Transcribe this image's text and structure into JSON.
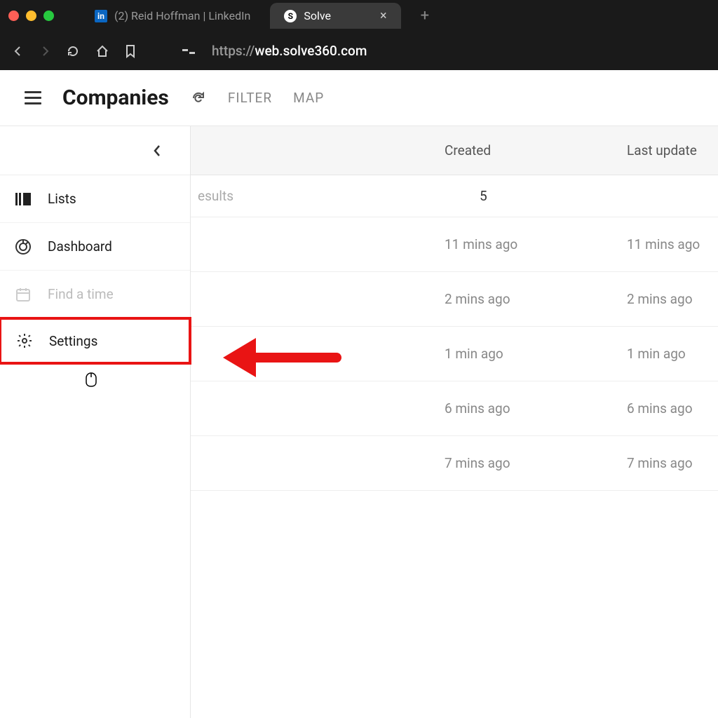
{
  "browser": {
    "tabs": [
      {
        "label": "(2) Reid Hoffman | LinkedIn",
        "iconText": "in"
      },
      {
        "label": "Solve",
        "iconText": "S"
      }
    ],
    "url_prefix": "https://",
    "url_host": "web.solve360.com"
  },
  "header": {
    "title": "Companies",
    "filter": "FILTER",
    "map": "MAP"
  },
  "sidebar": {
    "items": [
      {
        "label": "Lists",
        "icon": "list-icon",
        "dim": false
      },
      {
        "label": "Dashboard",
        "icon": "target-icon",
        "dim": false
      },
      {
        "label": "Find a time",
        "icon": "calendar-icon",
        "dim": true
      },
      {
        "label": "Settings",
        "icon": "gear-icon",
        "dim": false,
        "highlight": true
      }
    ]
  },
  "table": {
    "col_created": "Created",
    "col_updated": "Last update",
    "results_label": "esults",
    "results_count": "5",
    "rows": [
      {
        "created": "11 mins ago",
        "updated": "11 mins ago"
      },
      {
        "created": "2 mins ago",
        "updated": "2 mins ago"
      },
      {
        "created": "1 min ago",
        "updated": "1 min ago"
      },
      {
        "created": "6 mins ago",
        "updated": "6 mins ago"
      },
      {
        "created": "7 mins ago",
        "updated": "7 mins ago"
      }
    ]
  },
  "annotation": {
    "arrow_color": "#e91414"
  }
}
